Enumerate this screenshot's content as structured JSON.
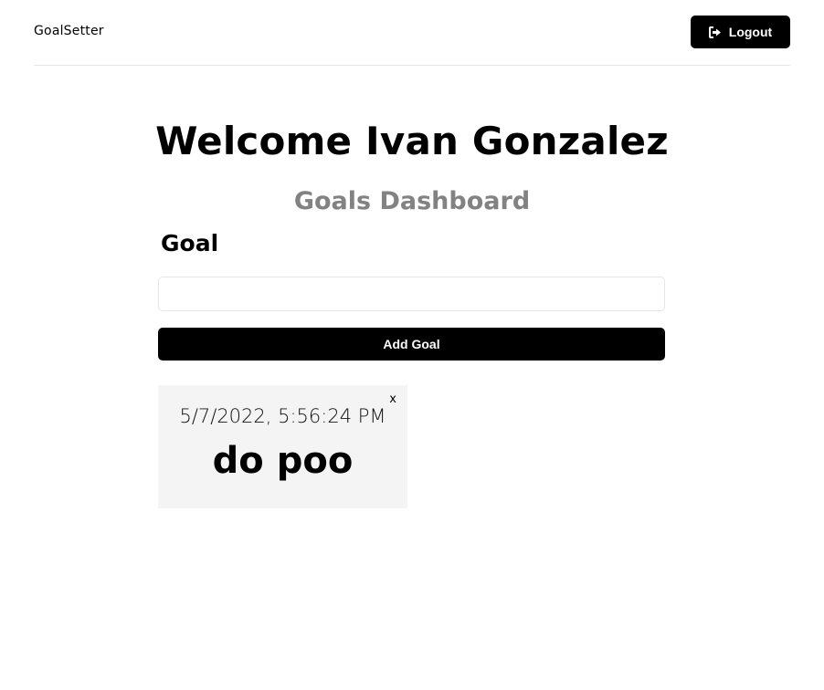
{
  "header": {
    "logo": "GoalSetter",
    "logout_label": "Logout",
    "logout_icon": "sign-out-icon"
  },
  "main": {
    "welcome": "Welcome Ivan Gonzalez",
    "subtitle": "Goals Dashboard",
    "form": {
      "goal_label": "Goal",
      "goal_value": "",
      "add_label": "Add Goal"
    },
    "goals": [
      {
        "date": "5/7/2022, 5:56:24 PM",
        "text": "do poo",
        "close_label": "x"
      }
    ]
  },
  "colors": {
    "primary": "#000000",
    "subtitle": "#828282",
    "card_background": "#f4f4f4",
    "border": "#e6e6e6"
  }
}
